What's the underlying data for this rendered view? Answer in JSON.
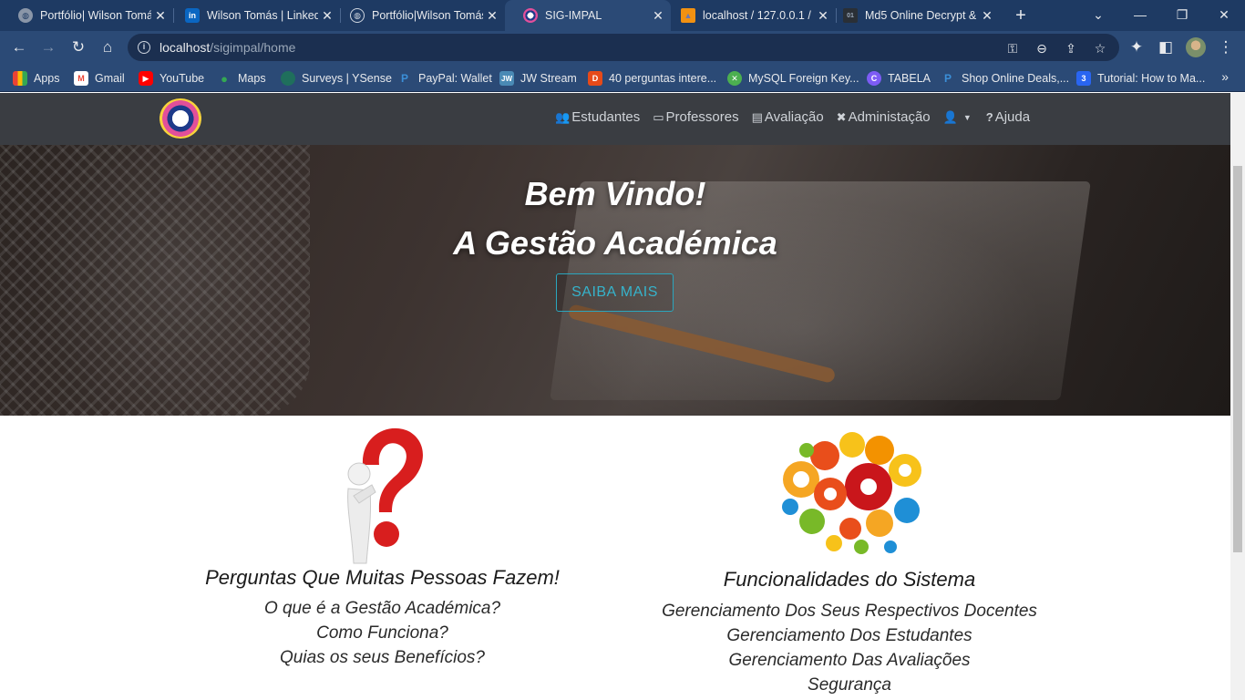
{
  "browser": {
    "tabs": [
      {
        "title": "Portfólio| Wilson Tomás",
        "favicon": "globe-icon",
        "active": false
      },
      {
        "title": "Wilson Tomás | LinkedIn",
        "favicon": "linkedin-icon",
        "active": false
      },
      {
        "title": "Portfólio|Wilson Tomás",
        "favicon": "globe-icon",
        "active": false
      },
      {
        "title": "SIG-IMPAL",
        "favicon": "site-logo-icon",
        "active": true
      },
      {
        "title": "localhost / 127.0.0.1 / ",
        "favicon": "phpmyadmin-icon",
        "active": false
      },
      {
        "title": "Md5 Online Decrypt & ",
        "favicon": "md5-icon",
        "active": false
      }
    ],
    "new_tab": "+",
    "address": {
      "host": "localhost",
      "path": "/sigimpal/home"
    },
    "window_controls": {
      "expand": "⌄",
      "minimize": "—",
      "restore": "❐",
      "close": "✕"
    }
  },
  "bookmarks": [
    {
      "label": "Apps",
      "icon": "apps-grid-icon",
      "color": "#ea4335"
    },
    {
      "label": "Gmail",
      "icon": "gmail-icon",
      "color": "#ea4335"
    },
    {
      "label": "YouTube",
      "icon": "youtube-icon",
      "color": "#ff0000"
    },
    {
      "label": "Maps",
      "icon": "maps-pin-icon",
      "color": "#34a853"
    },
    {
      "label": "Surveys | YSense",
      "icon": "ysense-icon",
      "color": "#1f6f5c"
    },
    {
      "label": "PayPal: Wallet",
      "icon": "paypal-icon",
      "color": "#0070ba"
    },
    {
      "label": "JW Stream",
      "icon": "jw-icon",
      "color": "#4a8ab5"
    },
    {
      "label": "40 perguntas intere...",
      "icon": "bookmark-red-icon",
      "color": "#e64a19"
    },
    {
      "label": "MySQL Foreign Key...",
      "icon": "mysql-icon",
      "color": "#4caf50"
    },
    {
      "label": "TABELA",
      "icon": "canva-icon",
      "color": "#7d5cf5"
    },
    {
      "label": "Shop Online Deals,...",
      "icon": "paypal-icon",
      "color": "#0070ba"
    },
    {
      "label": "Tutorial: How to Ma...",
      "icon": "css3-icon",
      "color": "#2965f1"
    }
  ],
  "site": {
    "nav": [
      {
        "label": "Estudantes",
        "icon": "users-icon"
      },
      {
        "label": "Professores",
        "icon": "chalkboard-teacher-icon"
      },
      {
        "label": "Avaliação",
        "icon": "list-alt-icon"
      },
      {
        "label": "Administação",
        "icon": "tools-icon"
      },
      {
        "label": "",
        "icon": "user-dropdown-icon"
      },
      {
        "label": "Ajuda",
        "icon": "question-icon"
      }
    ],
    "hero": {
      "line1": "Bem Vindo!",
      "line2": "A Gestão Académica",
      "button": "SAIBA MAIS"
    },
    "faq": {
      "title": "Perguntas Que Muitas Pessoas Fazem!",
      "items": [
        "O que é a Gestão Académica?",
        "Como Funciona?",
        "Quias os seus Benefícios?"
      ]
    },
    "features": {
      "title": "Funcionalidades do Sistema",
      "items": [
        "Gerenciamento Dos Seus Respectivos Docentes",
        "Gerenciamento Dos Estudantes",
        "Gerenciamento Das Avaliações",
        "Segurança"
      ]
    }
  }
}
